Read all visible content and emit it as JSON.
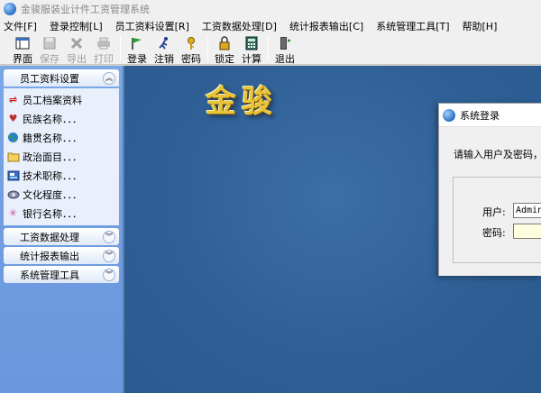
{
  "window": {
    "title": "金骏服装业计件工资管理系统"
  },
  "menu": [
    "文件[F]",
    "登录控制[L]",
    "员工资料设置[R]",
    "工资数据处理[D]",
    "统计报表输出[C]",
    "系统管理工具[T]",
    "帮助[H]"
  ],
  "toolbar": {
    "buttons": [
      {
        "label": "界面",
        "icon": "layout-icon",
        "enabled": true
      },
      {
        "label": "保存",
        "icon": "save-icon",
        "enabled": false
      },
      {
        "label": "导出",
        "icon": "export-icon",
        "enabled": false
      },
      {
        "label": "打印",
        "icon": "print-icon",
        "enabled": false
      },
      {
        "label": "登录",
        "icon": "login-flag-icon",
        "enabled": true
      },
      {
        "label": "注销",
        "icon": "logout-runner-icon",
        "enabled": true
      },
      {
        "label": "密码",
        "icon": "key-icon",
        "enabled": true
      },
      {
        "label": "锁定",
        "icon": "lock-icon",
        "enabled": true
      },
      {
        "label": "计算",
        "icon": "calculator-icon",
        "enabled": true
      },
      {
        "label": "退出",
        "icon": "exit-door-icon",
        "enabled": true
      }
    ]
  },
  "sidebar": {
    "groups": [
      {
        "title": "员工资料设置",
        "expanded": true,
        "items": [
          {
            "label": "员工档案资料",
            "icon": "employee-record-icon"
          },
          {
            "label": "民族名称．．．",
            "icon": "heart-icon"
          },
          {
            "label": "籍贯名称．．．",
            "icon": "globe-icon"
          },
          {
            "label": "政治面目．．．",
            "icon": "folder-icon"
          },
          {
            "label": "技术职称．．．",
            "icon": "certificate-icon"
          },
          {
            "label": "文化程度．．．",
            "icon": "education-icon"
          },
          {
            "label": "银行名称．．．",
            "icon": "bank-icon"
          }
        ]
      },
      {
        "title": "工资数据处理",
        "expanded": false
      },
      {
        "title": "统计报表输出",
        "expanded": false
      },
      {
        "title": "系统管理工具",
        "expanded": false
      }
    ]
  },
  "main": {
    "brand_text": "金骏"
  },
  "login_dialog": {
    "title": "系统登录",
    "prompt": "请输入用户及密码，",
    "user_label": "用户:",
    "user_value": "Admin",
    "password_label": "密码:",
    "password_value": ""
  }
}
